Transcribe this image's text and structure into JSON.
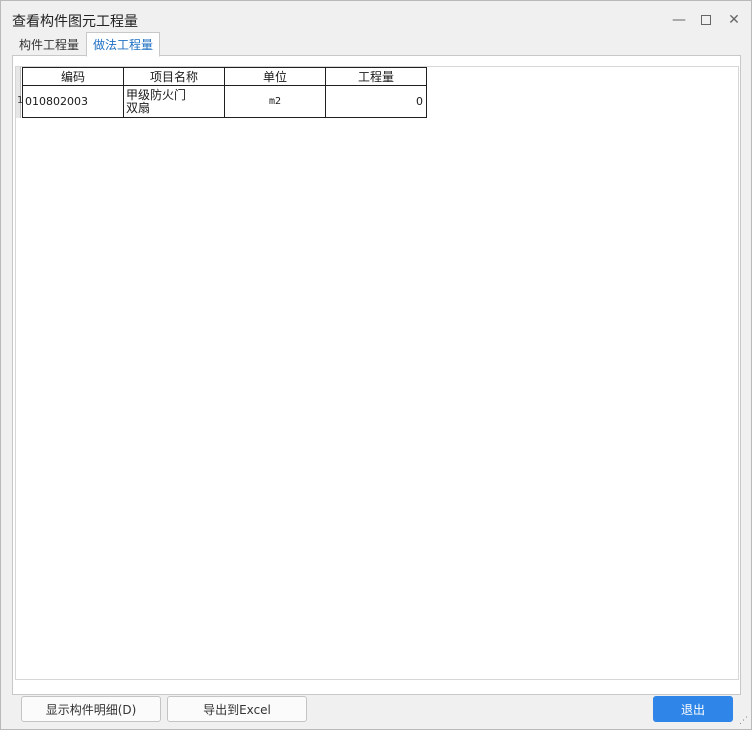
{
  "window": {
    "title": "查看构件图元工程量"
  },
  "tabs": [
    {
      "label": "构件工程量",
      "active": false
    },
    {
      "label": "做法工程量",
      "active": true
    }
  ],
  "table": {
    "columns": [
      "编码",
      "项目名称",
      "单位",
      "工程量"
    ],
    "rows": [
      {
        "row_number": "1",
        "code": "010802003",
        "name_line1": "甲级防火门",
        "name_line2": "双扇",
        "unit": "m2",
        "quantity": "0"
      }
    ]
  },
  "buttons": {
    "detail": "显示构件明细(D)",
    "export": "导出到Excel",
    "exit": "退出"
  },
  "colors": {
    "accent": "#2f86e8",
    "active_tab_text": "#1d6fc2"
  }
}
